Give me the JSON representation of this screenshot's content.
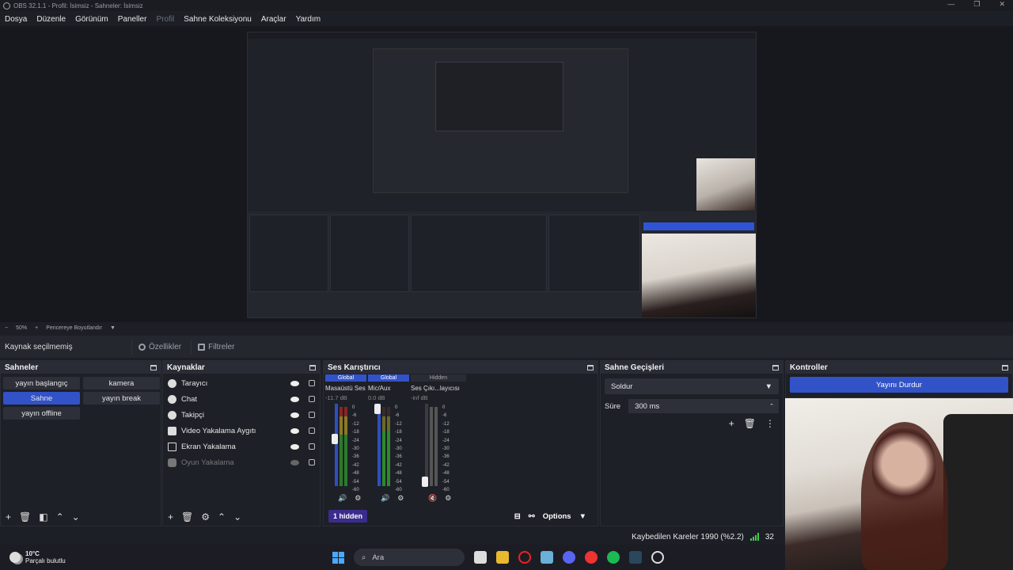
{
  "window": {
    "title": "OBS 32.1.1 - Profil: İsimsiz - Sahneler: İsimsiz"
  },
  "menu": [
    "Dosya",
    "Düzenle",
    "Görünüm",
    "Paneller",
    "Profil",
    "Sahne Koleksiyonu",
    "Araçlar",
    "Yardım"
  ],
  "zoom": {
    "level": "50%",
    "mode": "Pencereye Boyutlandır"
  },
  "source_toolbar": {
    "status": "Kaynak seçilmemiş",
    "properties": "Özellikler",
    "filters": "Filtreler"
  },
  "scenes": {
    "title": "Sahneler",
    "items": [
      "yayın başlangıç",
      "kamera",
      "Sahne",
      "yayın break",
      "yayın offline"
    ],
    "active": "Sahne"
  },
  "sources": {
    "title": "Kaynaklar",
    "items": [
      "Tarayıcı",
      "Chat",
      "Takipçi",
      "Video Yakalama Aygıtı",
      "Ekran Yakalama",
      "Oyun Yakalama"
    ]
  },
  "mixer": {
    "title": "Ses Karıştırıcı",
    "channels": [
      {
        "tag": "Global",
        "name": "Masaüstü Ses",
        "db": "-11.7 dB"
      },
      {
        "tag": "Global",
        "name": "Mic/Aux",
        "db": "0.0 dB"
      },
      {
        "tag": "Hidden",
        "name": "Ses Çıkı...layıcısı",
        "db": "-inf dB"
      }
    ],
    "scale": [
      "0",
      "-6",
      "-12",
      "-18",
      "-24",
      "-30",
      "-36",
      "-42",
      "-48",
      "-54",
      "-60"
    ],
    "hidden_label": "1 hidden",
    "options_label": "Options"
  },
  "transitions": {
    "title": "Sahne Geçişleri",
    "selected": "Soldur",
    "duration_label": "Süre",
    "duration": "300 ms"
  },
  "controls": {
    "title": "Kontroller",
    "stop_label": "Yayını Durdur"
  },
  "status": {
    "dropped": "Kaybedilen Kareler 1990 (%2.2)",
    "cpu_partial": "32"
  },
  "taskbar": {
    "temp": "10°C",
    "weather": "Parçalı bulutlu",
    "search_placeholder": "Ara"
  }
}
